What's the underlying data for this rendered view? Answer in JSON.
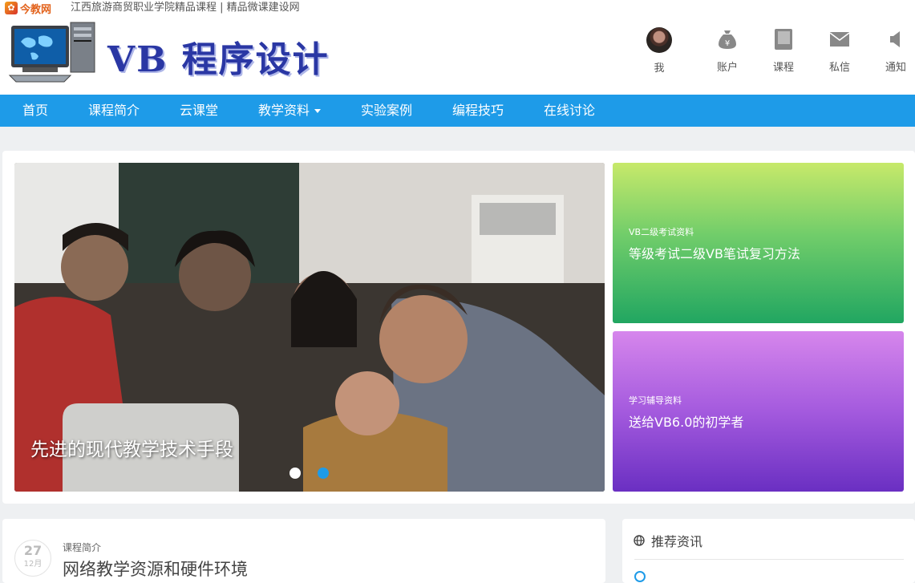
{
  "topbar": {
    "logo_text": "今教网",
    "site_title": "江西旅游商贸职业学院精品课程 | 精品微课建设网"
  },
  "header": {
    "brand": "VB 程序设计",
    "user_nav": [
      {
        "label": "我",
        "icon": "avatar"
      },
      {
        "label": "账户",
        "icon": "money-bag-icon"
      },
      {
        "label": "课程",
        "icon": "book-icon"
      },
      {
        "label": "私信",
        "icon": "mail-icon"
      },
      {
        "label": "通知",
        "icon": "speaker-icon"
      }
    ]
  },
  "nav": {
    "items": [
      {
        "label": "首页"
      },
      {
        "label": "课程简介"
      },
      {
        "label": "云课堂"
      },
      {
        "label": "教学资料",
        "dropdown": true
      },
      {
        "label": "实验案例"
      },
      {
        "label": "编程技巧"
      },
      {
        "label": "在线讨论"
      }
    ]
  },
  "slider": {
    "caption": "先进的现代教学技术手段",
    "slide_count": 2,
    "active_index": 1,
    "colors": {
      "active": "#1e9be8",
      "inactive": "#ffffff"
    }
  },
  "tiles": [
    {
      "category": "VB二级考试资料",
      "title": "等级考试二级VB笔试复习方法",
      "color": "#4cbb64"
    },
    {
      "category": "学习辅导资料",
      "title": "送给VB6.0的初学者",
      "color": "#9b4fdc"
    }
  ],
  "post": {
    "day": "27",
    "month": "12月",
    "category": "课程简介",
    "title": "网络教学资源和硬件环境"
  },
  "sidebar": {
    "heading": "推荐资讯",
    "icon": "globe-icon"
  },
  "colors": {
    "accent": "#1e9be8",
    "brand_text": "#2a37a4",
    "page_bg": "#eef0f2"
  }
}
